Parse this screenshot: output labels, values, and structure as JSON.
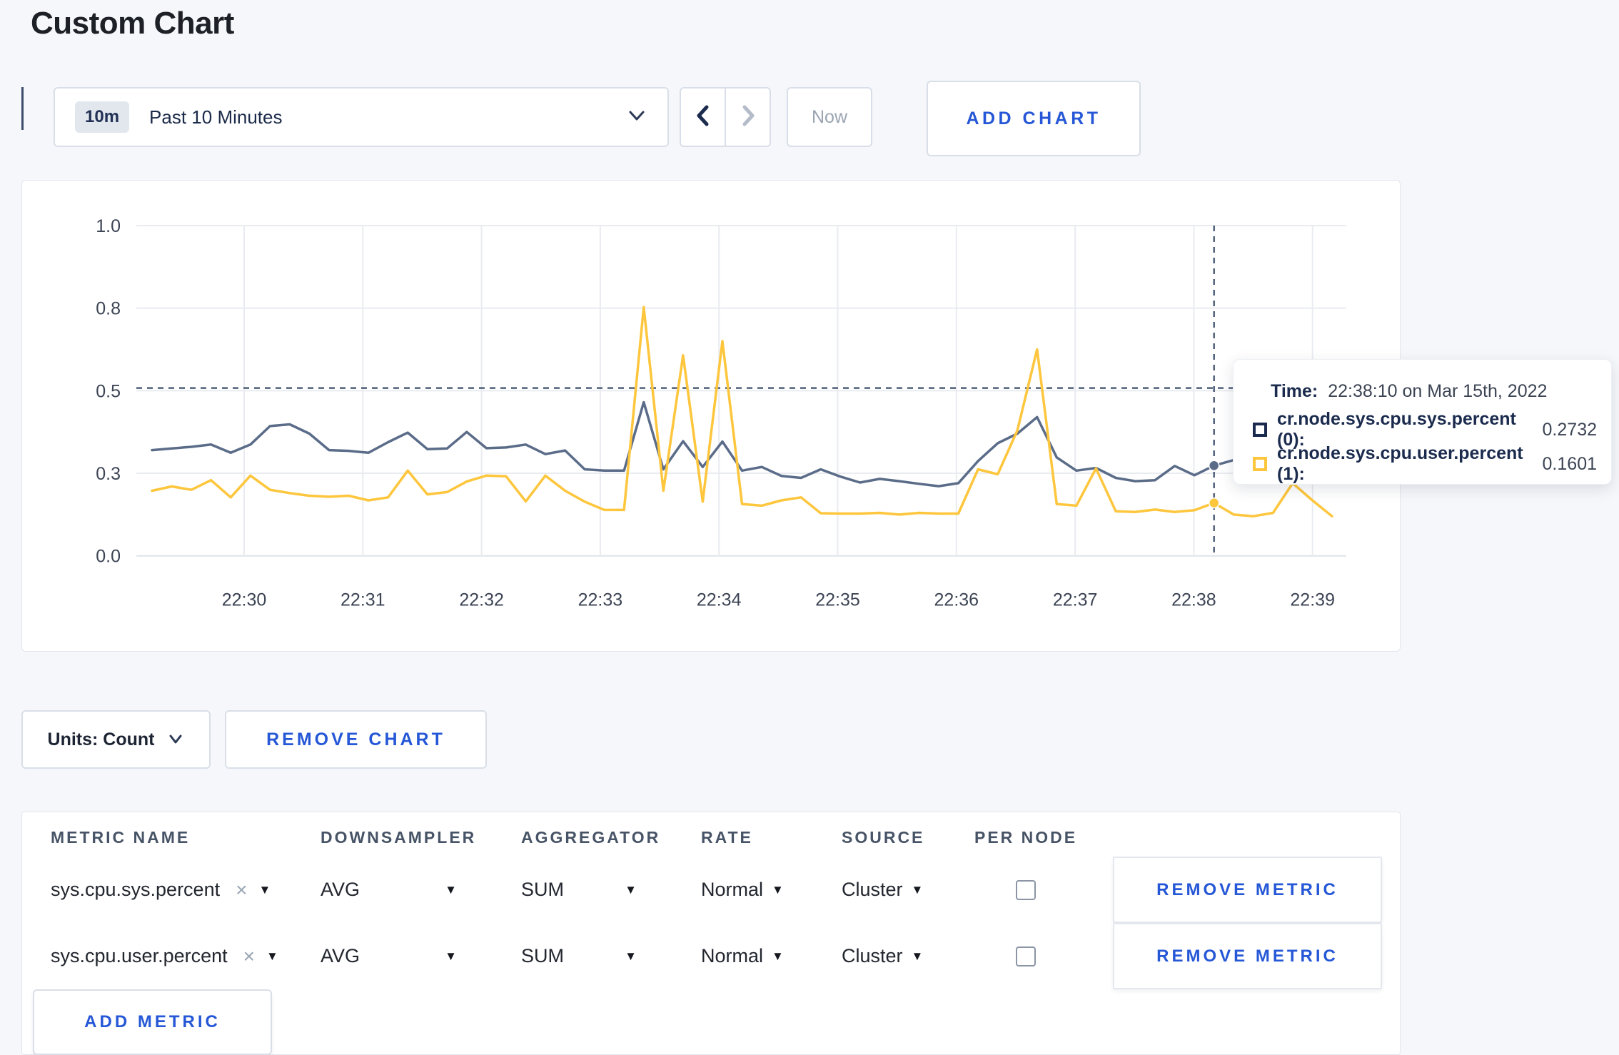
{
  "page": {
    "title": "Custom Chart"
  },
  "toolbar": {
    "time_badge": "10m",
    "time_label": "Past 10 Minutes",
    "now_label": "Now",
    "add_chart_label": "ADD CHART"
  },
  "chart_data": {
    "type": "line",
    "title": "",
    "xlabel": "",
    "ylabel": "",
    "ylim": [
      0,
      1
    ],
    "grid": true,
    "x_start": "22:29:10",
    "x_end": "22:39:10",
    "interval_seconds": 10,
    "x_ticks": [
      "22:30",
      "22:31",
      "22:32",
      "22:33",
      "22:34",
      "22:35",
      "22:36",
      "22:37",
      "22:38",
      "22:39"
    ],
    "y_tick_values": [
      0,
      0.25,
      0.5,
      0.75,
      1.0
    ],
    "y_tick_labels": [
      "0.0",
      "0.3",
      "0.5",
      "0.8",
      "1.0"
    ],
    "series": [
      {
        "name": "cr.node.sys.cpu.sys.percent (0)",
        "color": "#5b6c89",
        "values": [
          0.32,
          0.325,
          0.33,
          0.337,
          0.312,
          0.337,
          0.393,
          0.398,
          0.37,
          0.32,
          0.318,
          0.312,
          0.344,
          0.373,
          0.323,
          0.325,
          0.375,
          0.326,
          0.328,
          0.337,
          0.308,
          0.319,
          0.262,
          0.258,
          0.258,
          0.465,
          0.262,
          0.347,
          0.269,
          0.346,
          0.258,
          0.269,
          0.242,
          0.236,
          0.262,
          0.24,
          0.222,
          0.233,
          0.226,
          0.218,
          0.211,
          0.22,
          0.287,
          0.341,
          0.37,
          0.42,
          0.298,
          0.258,
          0.266,
          0.236,
          0.226,
          0.229,
          0.272,
          0.244,
          0.2732,
          0.29,
          0.3,
          0.295,
          0.3,
          0.305,
          0.3
        ]
      },
      {
        "name": "cr.node.sys.cpu.user.percent (1)",
        "color": "#fdc63d",
        "values": [
          0.197,
          0.21,
          0.2,
          0.229,
          0.177,
          0.243,
          0.2,
          0.19,
          0.182,
          0.179,
          0.182,
          0.168,
          0.177,
          0.258,
          0.186,
          0.193,
          0.225,
          0.243,
          0.241,
          0.165,
          0.243,
          0.197,
          0.164,
          0.139,
          0.139,
          0.753,
          0.197,
          0.607,
          0.164,
          0.65,
          0.157,
          0.152,
          0.168,
          0.177,
          0.129,
          0.128,
          0.128,
          0.13,
          0.125,
          0.13,
          0.128,
          0.128,
          0.262,
          0.247,
          0.38,
          0.625,
          0.157,
          0.152,
          0.265,
          0.135,
          0.133,
          0.14,
          0.133,
          0.138,
          0.1601,
          0.125,
          0.12,
          0.13,
          0.22,
          0.168,
          0.12
        ]
      }
    ],
    "crosshair": {
      "time": "22:38:10",
      "index": 54,
      "y_fraction": 0.508
    },
    "legend_position": "tooltip"
  },
  "tooltip": {
    "time_label": "Time:",
    "time_value": "22:38:10 on Mar 15th, 2022",
    "rows": [
      {
        "label": "cr.node.sys.cpu.sys.percent (0):",
        "value": "0.2732",
        "color": "#1b2b4e"
      },
      {
        "label": "cr.node.sys.cpu.user.percent (1):",
        "value": "0.1601",
        "color": "#fdc63d"
      }
    ]
  },
  "chart_controls": {
    "units_label": "Units: Count",
    "remove_chart_label": "REMOVE CHART"
  },
  "metrics_table": {
    "headers": [
      "METRIC NAME",
      "DOWNSAMPLER",
      "AGGREGATOR",
      "RATE",
      "SOURCE",
      "PER NODE"
    ],
    "rows": [
      {
        "metric": "sys.cpu.sys.percent",
        "clear": "×",
        "downsampler": "AVG",
        "aggregator": "SUM",
        "rate": "Normal",
        "source": "Cluster",
        "per_node_checked": false,
        "remove_label": "REMOVE METRIC"
      },
      {
        "metric": "sys.cpu.user.percent",
        "clear": "×",
        "downsampler": "AVG",
        "aggregator": "SUM",
        "rate": "Normal",
        "source": "Cluster",
        "per_node_checked": false,
        "remove_label": "REMOVE METRIC"
      }
    ],
    "add_metric_label": "ADD METRIC"
  },
  "icons": {
    "chevron_down": "chevron-down",
    "chevron_left": "chevron-left",
    "chevron_right": "chevron-right"
  },
  "colors": {
    "accent_blue": "#2557d6",
    "navy_text": "#1b2b4e",
    "gridline": "#e9ebf0",
    "crosshair": "#4f6079",
    "page_bg": "#f5f7fa"
  }
}
